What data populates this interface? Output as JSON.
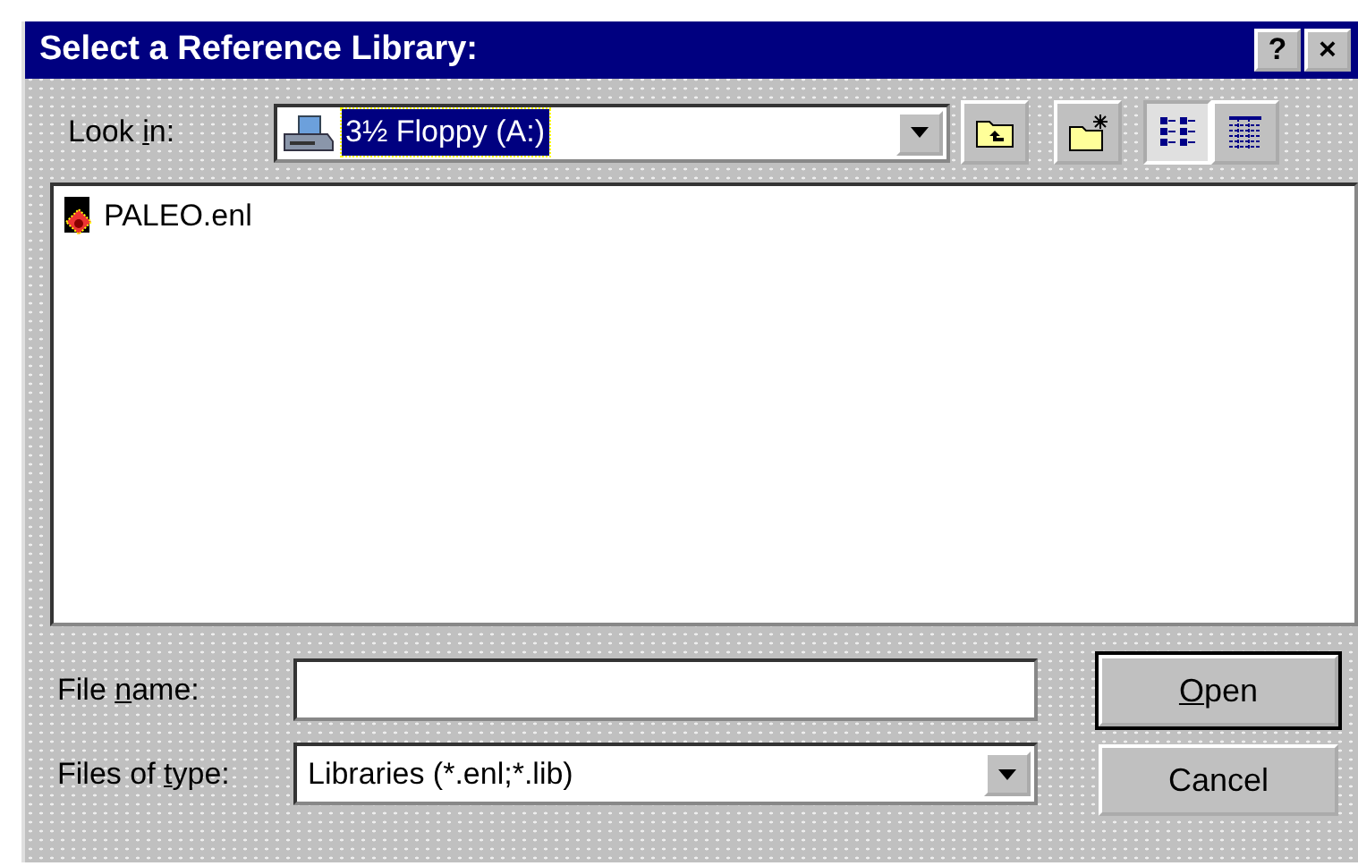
{
  "window": {
    "title": "Select a Reference Library:",
    "title_buttons": [
      "?",
      "×"
    ]
  },
  "look_in": {
    "label_parts": [
      {
        "text": "Look ",
        "underlined": false
      },
      {
        "text": "i",
        "underlined": true
      },
      {
        "text": "n:",
        "underlined": false
      }
    ],
    "value": "3½ Floppy (A:)",
    "highlighted": true
  },
  "toolbar": [
    {
      "kind": "up",
      "selected": false
    },
    {
      "kind": "new_folder",
      "selected": false
    },
    {
      "kind": "list",
      "selected": true
    },
    {
      "kind": "details",
      "selected": false
    }
  ],
  "files": [
    {
      "name": "PALEO.enl"
    }
  ],
  "file_name": {
    "label_parts": [
      {
        "text": "File ",
        "underlined": false
      },
      {
        "text": "n",
        "underlined": true
      },
      {
        "text": "ame:",
        "underlined": false
      }
    ]
  },
  "files_of_type": {
    "label_parts": [
      {
        "text": "Files of ",
        "underlined": false
      },
      {
        "text": "t",
        "underlined": true
      },
      {
        "text": "ype:",
        "underlined": false
      }
    ],
    "value": "Libraries (*.enl;*.lib)"
  },
  "buttons": [
    {
      "label_parts": [
        {
          "text": "O",
          "underlined": true
        },
        {
          "text": "pen",
          "underlined": false
        }
      ],
      "default": true
    },
    {
      "label_parts": [
        {
          "text": "Cancel",
          "underlined": false
        }
      ],
      "default": false
    }
  ]
}
